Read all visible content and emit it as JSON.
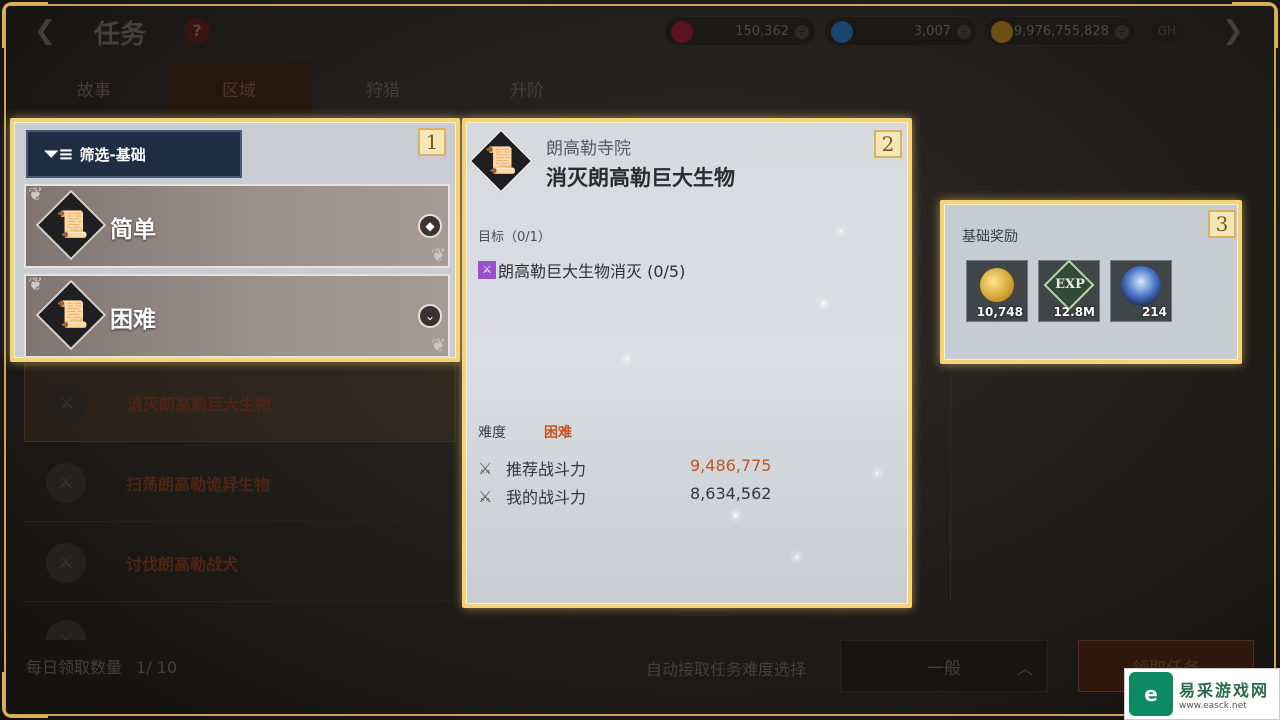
{
  "header": {
    "title": "任务",
    "help_label": "?",
    "currencies": [
      {
        "name": "red-gem",
        "value": "150,362",
        "color": "#c0304a"
      },
      {
        "name": "blue-gem",
        "value": "3,007",
        "color": "#3a8ad8"
      },
      {
        "name": "gold",
        "value": "9,976,755,828",
        "color": "#d8a030"
      }
    ],
    "extra_label": "GH"
  },
  "tabs": [
    {
      "label": "故事"
    },
    {
      "label": "区域"
    },
    {
      "label": "狩猎"
    },
    {
      "label": "升阶"
    }
  ],
  "filter": {
    "badge": "1",
    "label": "筛选-基础",
    "options": [
      {
        "label": "简单"
      },
      {
        "label": "困难"
      }
    ]
  },
  "quest_list": [
    {
      "label": "消灭朗高勒巨大生物"
    },
    {
      "label": "扫荡朗高勒诡异生物"
    },
    {
      "label": "讨伐朗高勒战犬"
    }
  ],
  "detail": {
    "badge": "2",
    "location": "朗高勒寺院",
    "name": "消灭朗高勒巨大生物",
    "goal_label": "目标（0/1）",
    "objective": "朗高勒巨大生物消灭 (0/5)",
    "difficulty_label": "难度",
    "difficulty_value": "困难",
    "recommended_label": "推荐战斗力",
    "recommended_value": "9,486,775",
    "my_label": "我的战斗力",
    "my_value": "8,634,562",
    "recommended_color": "#c4541c"
  },
  "rewards": {
    "badge": "3",
    "label": "基础奖励",
    "items": [
      {
        "icon": "gold-coins-icon",
        "value": "10,748"
      },
      {
        "icon": "exp-icon",
        "text": "EXP",
        "value": "12.8M"
      },
      {
        "icon": "blue-orb-icon",
        "value": "214"
      }
    ]
  },
  "footer": {
    "daily_label": "每日领取数量",
    "daily_value": "1/ 10",
    "auto_label": "自动接取任务难度选择",
    "auto_value": "一般",
    "accept_label": "领取任务"
  },
  "watermark": {
    "name": "易采游戏网",
    "url": "www.easck.net"
  }
}
